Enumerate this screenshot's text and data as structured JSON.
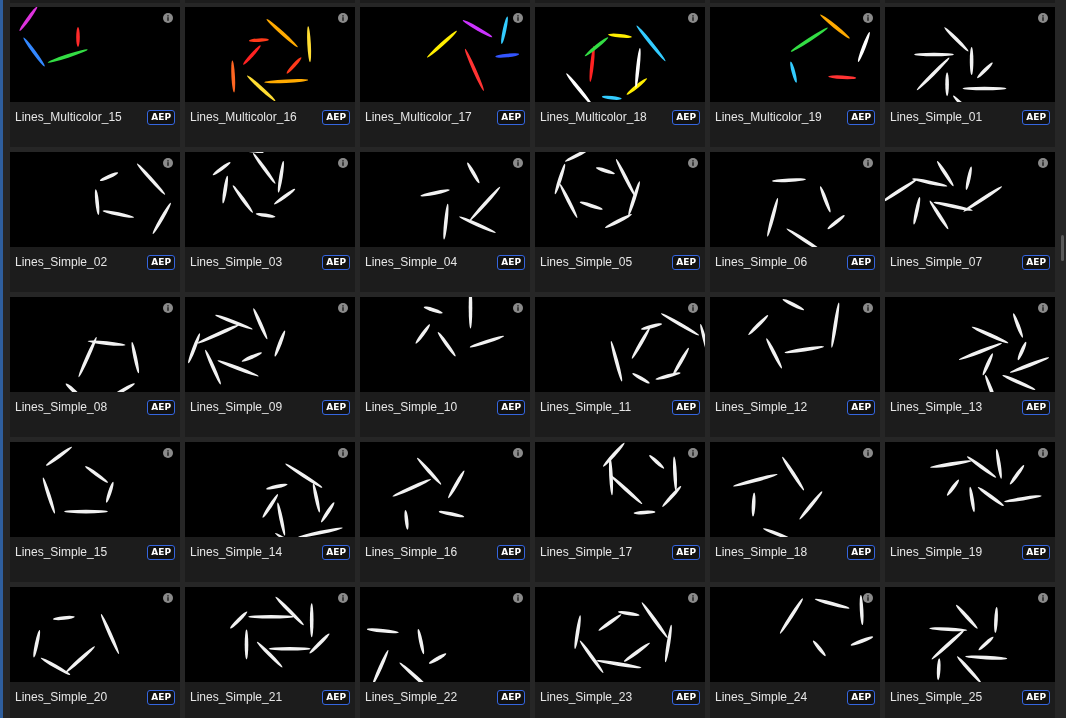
{
  "assets": [
    {
      "name": "Lines_Multicolor_15",
      "badge": "AEP"
    },
    {
      "name": "Lines_Multicolor_16",
      "badge": "AEP"
    },
    {
      "name": "Lines_Multicolor_17",
      "badge": "AEP"
    },
    {
      "name": "Lines_Multicolor_18",
      "badge": "AEP"
    },
    {
      "name": "Lines_Multicolor_19",
      "badge": "AEP"
    },
    {
      "name": "Lines_Simple_01",
      "badge": "AEP"
    },
    {
      "name": "Lines_Simple_02",
      "badge": "AEP"
    },
    {
      "name": "Lines_Simple_03",
      "badge": "AEP"
    },
    {
      "name": "Lines_Simple_04",
      "badge": "AEP"
    },
    {
      "name": "Lines_Simple_05",
      "badge": "AEP"
    },
    {
      "name": "Lines_Simple_06",
      "badge": "AEP"
    },
    {
      "name": "Lines_Simple_07",
      "badge": "AEP"
    },
    {
      "name": "Lines_Simple_08",
      "badge": "AEP"
    },
    {
      "name": "Lines_Simple_09",
      "badge": "AEP"
    },
    {
      "name": "Lines_Simple_10",
      "badge": "AEP"
    },
    {
      "name": "Lines_Simple_11",
      "badge": "AEP"
    },
    {
      "name": "Lines_Simple_12",
      "badge": "AEP"
    },
    {
      "name": "Lines_Simple_13",
      "badge": "AEP"
    },
    {
      "name": "Lines_Simple_15",
      "badge": "AEP"
    },
    {
      "name": "Lines_Simple_14",
      "badge": "AEP"
    },
    {
      "name": "Lines_Simple_16",
      "badge": "AEP"
    },
    {
      "name": "Lines_Simple_17",
      "badge": "AEP"
    },
    {
      "name": "Lines_Simple_18",
      "badge": "AEP"
    },
    {
      "name": "Lines_Simple_19",
      "badge": "AEP"
    },
    {
      "name": "Lines_Simple_20",
      "badge": "AEP"
    },
    {
      "name": "Lines_Simple_21",
      "badge": "AEP"
    },
    {
      "name": "Lines_Simple_22",
      "badge": "AEP"
    },
    {
      "name": "Lines_Simple_23",
      "badge": "AEP"
    },
    {
      "name": "Lines_Simple_24",
      "badge": "AEP"
    },
    {
      "name": "Lines_Simple_25",
      "badge": "AEP"
    }
  ]
}
